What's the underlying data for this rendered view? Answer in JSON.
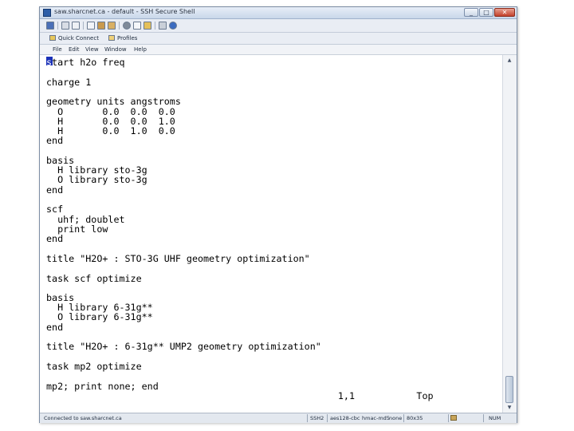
{
  "window": {
    "title": "saw.sharcnet.ca - default - SSH Secure Shell",
    "buttons": {
      "minimize": "_",
      "maximize": "□",
      "close": "✕"
    }
  },
  "toolbar": {
    "icons": [
      "save-icon",
      "print-icon",
      "print-preview-icon",
      "copy-icon",
      "paste-icon",
      "paste-alt-icon",
      "find-icon",
      "new-terminal-icon",
      "new-file-transfer-icon",
      "settings-icon",
      "help-icon"
    ]
  },
  "profile_bar": {
    "quick_connect": "Quick Connect",
    "profiles": "Profiles"
  },
  "menu": [
    "File",
    "Edit",
    "View",
    "Window",
    "Help"
  ],
  "terminal": {
    "lines": [
      "start h2o freq",
      "",
      "charge 1",
      "",
      "geometry units angstroms",
      "  O       0.0  0.0  0.0",
      "  H       0.0  0.0  1.0",
      "  H       0.0  1.0  0.0",
      "end",
      "",
      "basis",
      "  H library sto-3g",
      "  O library sto-3g",
      "end",
      "",
      "scf",
      "  uhf; doublet",
      "  print low",
      "end",
      "",
      "title \"H2O+ : STO-3G UHF geometry optimization\"",
      "",
      "task scf optimize",
      "",
      "basis",
      "  H library 6-31g**",
      "  O library 6-31g**",
      "end",
      "",
      "title \"H2O+ : 6-31g** UMP2 geometry optimization\"",
      "",
      "task mp2 optimize",
      "",
      "mp2; print none; end",
      "                                                    1,1           Top"
    ],
    "cursor_char": "s"
  },
  "status_bar": {
    "connection": "Connected to saw.sharcnet.ca",
    "protocol": "SSH2",
    "cipher": "aes128-cbc",
    "mac": "hmac-md5",
    "compression": "none",
    "size": "80x35",
    "num": "NUM"
  }
}
